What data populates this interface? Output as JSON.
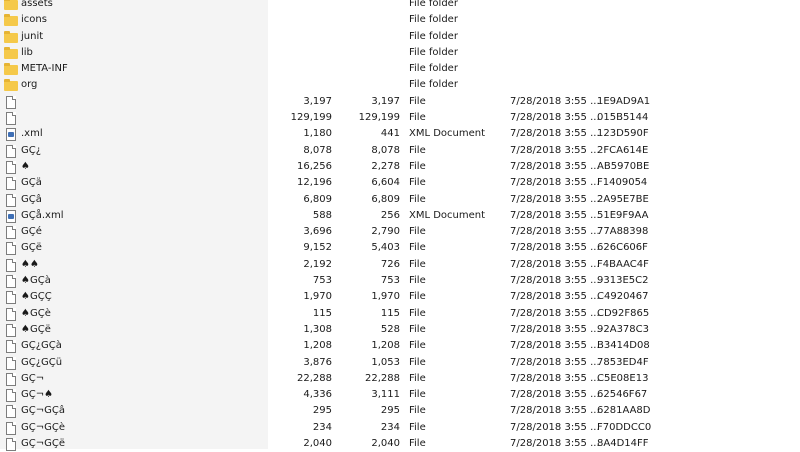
{
  "rows": [
    {
      "name": "assets",
      "size": "",
      "packed": "",
      "type": "File folder",
      "modified": "",
      "crc": "",
      "icon": "folder-icon"
    },
    {
      "name": "icons",
      "size": "",
      "packed": "",
      "type": "File folder",
      "modified": "",
      "crc": "",
      "icon": "folder-icon"
    },
    {
      "name": "junit",
      "size": "",
      "packed": "",
      "type": "File folder",
      "modified": "",
      "crc": "",
      "icon": "folder-icon"
    },
    {
      "name": "lib",
      "size": "",
      "packed": "",
      "type": "File folder",
      "modified": "",
      "crc": "",
      "icon": "folder-icon"
    },
    {
      "name": "META-INF",
      "size": "",
      "packed": "",
      "type": "File folder",
      "modified": "",
      "crc": "",
      "icon": "folder-icon"
    },
    {
      "name": "org",
      "size": "",
      "packed": "",
      "type": "File folder",
      "modified": "",
      "crc": "",
      "icon": "folder-icon"
    },
    {
      "name": "",
      "size": "3,197",
      "packed": "3,197",
      "type": "File",
      "modified": "7/28/2018 3:55 ...",
      "crc": "1E9AD9A1",
      "icon": "file-icon"
    },
    {
      "name": "",
      "size": "129,199",
      "packed": "129,199",
      "type": "File",
      "modified": "7/28/2018 3:55 ...",
      "crc": "015B5144",
      "icon": "file-icon"
    },
    {
      "name": ".xml",
      "size": "1,180",
      "packed": "441",
      "type": "XML Document",
      "modified": "7/28/2018 3:55 ...",
      "crc": "123D590F",
      "icon": "xml-file-icon"
    },
    {
      "name": "GÇ¿",
      "size": "8,078",
      "packed": "8,078",
      "type": "File",
      "modified": "7/28/2018 3:55 ...",
      "crc": "2FCA614E",
      "icon": "file-icon"
    },
    {
      "name": "♠",
      "size": "16,256",
      "packed": "2,278",
      "type": "File",
      "modified": "7/28/2018 3:55 ...",
      "crc": "AB5970BE",
      "icon": "file-icon"
    },
    {
      "name": "GÇä",
      "size": "12,196",
      "packed": "6,604",
      "type": "File",
      "modified": "7/28/2018 3:55 ...",
      "crc": "F1409054",
      "icon": "file-icon"
    },
    {
      "name": "GÇâ",
      "size": "6,809",
      "packed": "6,809",
      "type": "File",
      "modified": "7/28/2018 3:55 ...",
      "crc": "2A95E7BE",
      "icon": "file-icon"
    },
    {
      "name": "GÇå.xml",
      "size": "588",
      "packed": "256",
      "type": "XML Document",
      "modified": "7/28/2018 3:55 ...",
      "crc": "51E9F9AA",
      "icon": "xml-file-icon"
    },
    {
      "name": "GÇé",
      "size": "3,696",
      "packed": "2,790",
      "type": "File",
      "modified": "7/28/2018 3:55 ...",
      "crc": "77A88398",
      "icon": "file-icon"
    },
    {
      "name": "GÇë",
      "size": "9,152",
      "packed": "5,403",
      "type": "File",
      "modified": "7/28/2018 3:55 ...",
      "crc": "626C606F",
      "icon": "file-icon"
    },
    {
      "name": "♠♠",
      "size": "2,192",
      "packed": "726",
      "type": "File",
      "modified": "7/28/2018 3:55 ...",
      "crc": "F4BAAC4F",
      "icon": "file-icon"
    },
    {
      "name": "♠GÇà",
      "size": "753",
      "packed": "753",
      "type": "File",
      "modified": "7/28/2018 3:55 ...",
      "crc": "9313E5C2",
      "icon": "file-icon"
    },
    {
      "name": "♠GÇÇ",
      "size": "1,970",
      "packed": "1,970",
      "type": "File",
      "modified": "7/28/2018 3:55 ...",
      "crc": "C4920467",
      "icon": "file-icon"
    },
    {
      "name": "♠GÇè",
      "size": "115",
      "packed": "115",
      "type": "File",
      "modified": "7/28/2018 3:55 ...",
      "crc": "CD92F865",
      "icon": "file-icon"
    },
    {
      "name": "♠GÇë",
      "size": "1,308",
      "packed": "528",
      "type": "File",
      "modified": "7/28/2018 3:55 ...",
      "crc": "92A378C3",
      "icon": "file-icon"
    },
    {
      "name": "GÇ¿GÇà",
      "size": "1,208",
      "packed": "1,208",
      "type": "File",
      "modified": "7/28/2018 3:55 ...",
      "crc": "B3414D08",
      "icon": "file-icon"
    },
    {
      "name": "GÇ¿GÇü",
      "size": "3,876",
      "packed": "1,053",
      "type": "File",
      "modified": "7/28/2018 3:55 ...",
      "crc": "7853ED4F",
      "icon": "file-icon"
    },
    {
      "name": "GÇ¬",
      "size": "22,288",
      "packed": "22,288",
      "type": "File",
      "modified": "7/28/2018 3:55 ...",
      "crc": "C5E08E13",
      "icon": "file-icon"
    },
    {
      "name": "GÇ¬♠",
      "size": "4,336",
      "packed": "3,111",
      "type": "File",
      "modified": "7/28/2018 3:55 ...",
      "crc": "62546F67",
      "icon": "file-icon"
    },
    {
      "name": "GÇ¬GÇâ",
      "size": "295",
      "packed": "295",
      "type": "File",
      "modified": "7/28/2018 3:55 ...",
      "crc": "6281AA8D",
      "icon": "file-icon"
    },
    {
      "name": "GÇ¬GÇè",
      "size": "234",
      "packed": "234",
      "type": "File",
      "modified": "7/28/2018 3:55 ...",
      "crc": "F70DDCC0",
      "icon": "file-icon"
    },
    {
      "name": "GÇ¬GÇë",
      "size": "2,040",
      "packed": "2,040",
      "type": "File",
      "modified": "7/28/2018 3:55 ...",
      "crc": "8A4D14FF",
      "icon": "file-icon"
    }
  ]
}
